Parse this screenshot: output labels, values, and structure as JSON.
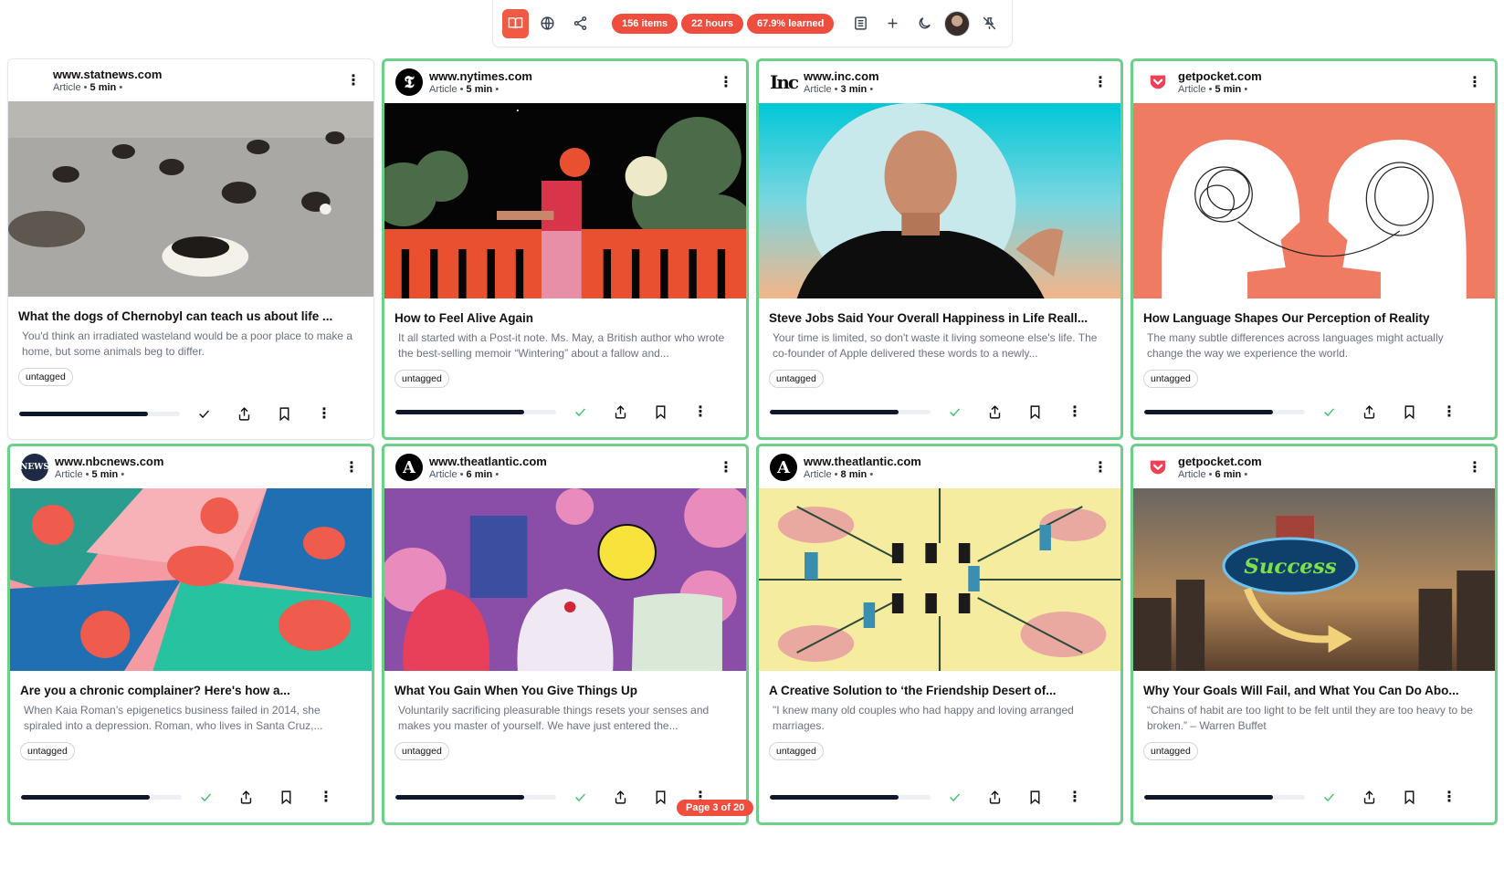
{
  "toolbar": {
    "items_count": "156 items",
    "hours": "22 hours",
    "learned": "67.9% learned",
    "icons": [
      "book-icon",
      "globe-icon",
      "share-nodes-icon",
      "list-icon",
      "plus-icon",
      "moon-icon",
      "avatar",
      "unpin-icon"
    ]
  },
  "pagination": {
    "label": "Page 3 of 20"
  },
  "cards": [
    {
      "site": "www.statnews.com",
      "type": "Article",
      "read_time": "5 min",
      "title": "What the dogs of Chernobyl can teach us about life ...",
      "desc": "You'd think an irradiated wasteland would be a poor place to make a home, but some animals beg to differ.",
      "tag": "untagged",
      "progress": 0.8,
      "read": false
    },
    {
      "site": "www.nytimes.com",
      "type": "Article",
      "read_time": "5 min",
      "title": "How to Feel Alive Again",
      "desc": "It all started with a Post-it note. Ms. May, a British author who wrote the best-selling memoir “Wintering” about a fallow and...",
      "tag": "untagged",
      "progress": 0.8,
      "read": true
    },
    {
      "site": "www.inc.com",
      "type": "Article",
      "read_time": "3 min",
      "title": "Steve Jobs Said Your Overall Happiness in Life Reall...",
      "desc": "Your time is limited, so don't waste it living someone else's life. The co-founder of Apple delivered these words to a newly...",
      "tag": "untagged",
      "progress": 0.8,
      "read": true
    },
    {
      "site": "getpocket.com",
      "type": "Article",
      "read_time": "5 min",
      "title": "How Language Shapes Our Perception of Reality",
      "desc": "The many subtle differences across languages might actually change the way we experience the world.",
      "tag": "untagged",
      "progress": 0.8,
      "read": true
    },
    {
      "site": "www.nbcnews.com",
      "type": "Article",
      "read_time": "5 min",
      "title": "Are you a chronic complainer? Here's how a...",
      "desc": "When Kaia Roman’s epigenetics business failed in 2014, she spiraled into a depression. Roman, who lives in Santa Cruz,...",
      "tag": "untagged",
      "progress": 0.8,
      "read": true
    },
    {
      "site": "www.theatlantic.com",
      "type": "Article",
      "read_time": "6 min",
      "title": "What You Gain When You Give Things Up",
      "desc": "Voluntarily sacrificing pleasurable things resets your senses and makes you master of yourself. We have just entered the...",
      "tag": "untagged",
      "progress": 0.8,
      "read": true
    },
    {
      "site": "www.theatlantic.com",
      "type": "Article",
      "read_time": "8 min",
      "title": "A Creative Solution to ‘the Friendship Desert of...",
      "desc": "\"I knew many old couples who had happy and loving arranged marriages.",
      "tag": "untagged",
      "progress": 0.8,
      "read": true
    },
    {
      "site": "getpocket.com",
      "type": "Article",
      "read_time": "6 min",
      "title": "Why Your Goals Will Fail, and What You Can Do Abo...",
      "desc": "“Chains of habit are too light to be felt until they are too heavy to be broken.” – Warren Buffet",
      "tag": "untagged",
      "progress": 0.8,
      "read": true
    }
  ],
  "colors": {
    "accent": "#ef4d3d",
    "read_border": "#6ccf8a",
    "check_green": "#3cc46a"
  }
}
